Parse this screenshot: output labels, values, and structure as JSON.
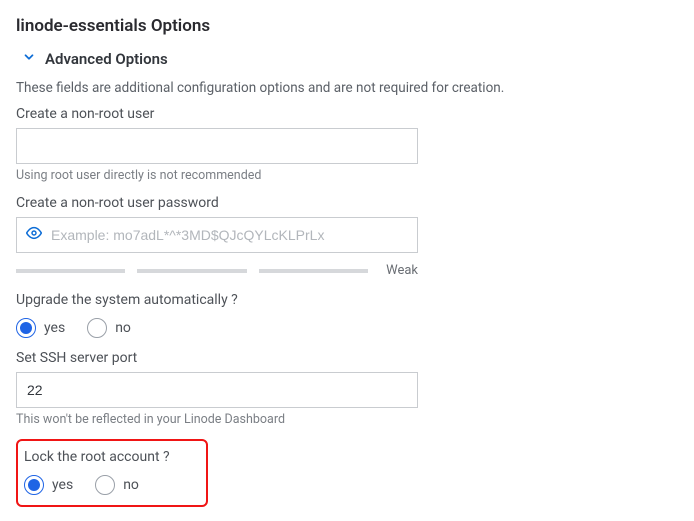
{
  "page": {
    "title": "linode-essentials Options",
    "advanced_header": "Advanced Options",
    "advanced_hint": "These fields are additional configuration options and are not required for creation."
  },
  "fields": {
    "nonroot_user_label": "Create a non-root user",
    "nonroot_user_value": "",
    "nonroot_user_hint": "Using root user directly is not recommended",
    "nonroot_pw_label": "Create a non-root user password",
    "nonroot_pw_placeholder": "Example: mo7adL*^*3MD$QJcQYLcKLPrLx",
    "nonroot_pw_value": "",
    "pw_strength_label": "Weak",
    "upgrade_label": "Upgrade the system automatically ?",
    "upgrade_yes": "yes",
    "upgrade_no": "no",
    "ssh_port_label": "Set SSH server port",
    "ssh_port_value": "22",
    "ssh_port_hint": "This won't be reflected in your Linode Dashboard",
    "lock_root_label": "Lock the root account ?",
    "lock_root_yes": "yes",
    "lock_root_no": "no"
  }
}
